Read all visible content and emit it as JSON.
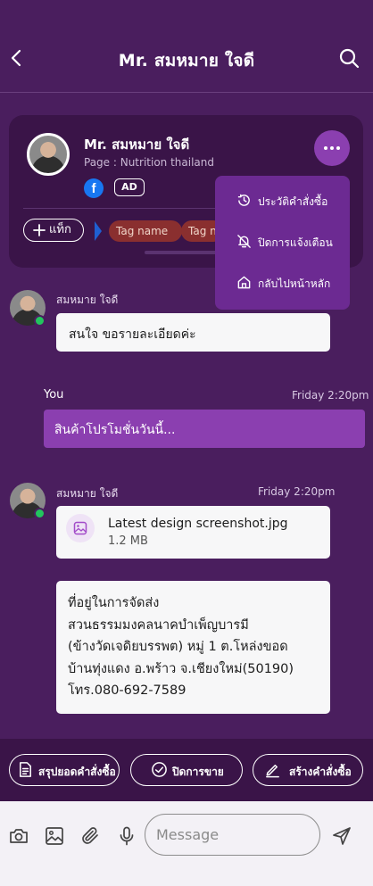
{
  "header": {
    "title": "Mr. สมหมาย ใจดี"
  },
  "profile": {
    "name": "Mr. สมหมาย ใจดี",
    "page": "Page : Nutrition thailand",
    "badge_ad": "AD",
    "facebook_letter": "f",
    "add_tag_label": "แท็ก",
    "tags": [
      "Tag name",
      "Tag name"
    ]
  },
  "dropdown": {
    "items": [
      {
        "label": "ประวัติคำสั่งซื้อ",
        "icon": "history-icon"
      },
      {
        "label": "ปิดการแจ้งเตือน",
        "icon": "bell-off-icon"
      },
      {
        "label": "กลับไปหน้าหลัก",
        "icon": "home-icon"
      }
    ]
  },
  "messages": [
    {
      "sender": "สมหมาย ใจดี",
      "text": "สนใจ ขอรายละเอียดค่ะ"
    },
    {
      "sender": "You",
      "time": "Friday 2:20pm",
      "text": "สินค้าโปรโมชั่นวันนี้..."
    },
    {
      "sender": "สมหมาย ใจดี",
      "time": "Friday 2:20pm",
      "file_name": "Latest design screenshot.jpg",
      "file_size": "1.2 MB"
    },
    {
      "address_lines": [
        "ที่อยู่ในการจัดส่ง",
        "สวนธรรมมงคลนาคบำเพ็ญบารมี",
        "(ข้างวัดเจดิยบรรพต) หมู่ 1 ต.โหล่งขอด",
        "บ้านทุ่งแดง อ.พร้าว  จ.เชียงใหม่(50190)",
        "โทร.080-692-7589"
      ]
    }
  ],
  "actions": {
    "summary_label": "สรุปยอดคำสั่งซื้อ",
    "close_sale_label": "ปิดการขาย",
    "create_order_label": "สร้างคำสั่งซื้อ"
  },
  "composer": {
    "placeholder": "Message"
  },
  "colors": {
    "background": "#4a1e5e",
    "card": "#3a1448",
    "accent": "#8b3fb0",
    "dropdown": "#6c2a92",
    "tag": "#8a2f2f",
    "online": "#22c55e"
  }
}
